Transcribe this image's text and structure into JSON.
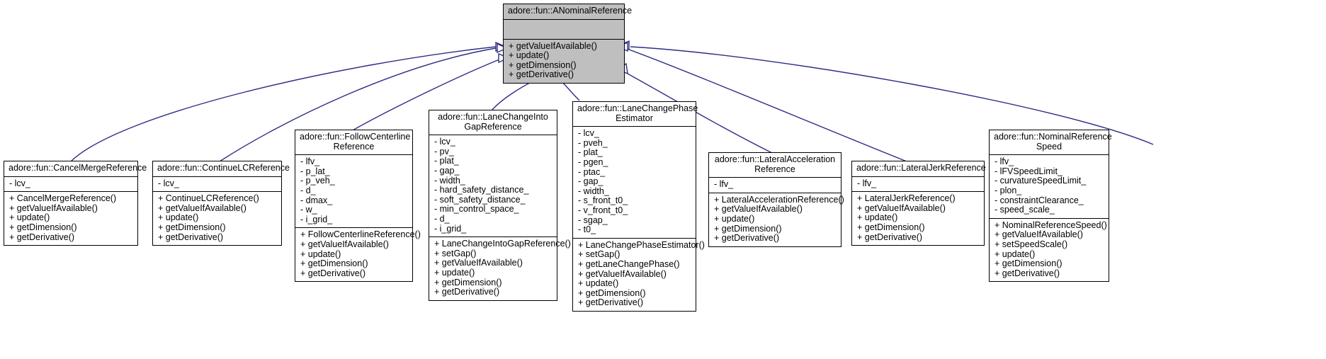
{
  "diagram": {
    "kind": "uml-inheritance",
    "background": "#ffffff",
    "edge_color": "#2d2d86",
    "root_fill": "#bfbfbf",
    "node_fill": "#ffffff",
    "border_color": "#000000"
  },
  "nodes": [
    {
      "id": "anominalreference",
      "title": "adore::fun::ANominalReference",
      "attrs": [],
      "ops": [
        "+ getValueIfAvailable()",
        "+ update()",
        "+ getDimension()",
        "+ getDerivative()"
      ]
    },
    {
      "id": "cancelmergereference",
      "title": "adore::fun::CancelMergeReference",
      "attrs": [
        "- lcv_"
      ],
      "ops": [
        "+ CancelMergeReference()",
        "+ getValueIfAvailable()",
        "+ update()",
        "+ getDimension()",
        "+ getDerivative()"
      ]
    },
    {
      "id": "continuelcreference",
      "title": "adore::fun::ContinueLCReference",
      "attrs": [
        "- lcv_"
      ],
      "ops": [
        "+ ContinueLCReference()",
        "+ getValueIfAvailable()",
        "+ update()",
        "+ getDimension()",
        "+ getDerivative()"
      ]
    },
    {
      "id": "followcenterlinereference",
      "title": "adore::fun::FollowCenterline\nReference",
      "attrs": [
        "- lfv_",
        "- p_lat_",
        "- p_veh_",
        "- d_",
        "- dmax_",
        "- w_",
        "- i_grid_"
      ],
      "ops": [
        "+ FollowCenterlineReference()",
        "+ getValueIfAvailable()",
        "+ update()",
        "+ getDimension()",
        "+ getDerivative()"
      ]
    },
    {
      "id": "lanechangeintogapreference",
      "title": "adore::fun::LaneChangeInto\nGapReference",
      "attrs": [
        "- lcv_",
        "- pv_",
        "- plat_",
        "- gap_",
        "- width_",
        "- hard_safety_distance_",
        "- soft_safety_distance_",
        "- min_control_space_",
        "- d_",
        "- i_grid_"
      ],
      "ops": [
        "+ LaneChangeIntoGapReference()",
        "+ setGap()",
        "+ getValueIfAvailable()",
        "+ update()",
        "+ getDimension()",
        "+ getDerivative()"
      ]
    },
    {
      "id": "lanechangephaseestimator",
      "title": "adore::fun::LaneChangePhase\nEstimator",
      "attrs": [
        "- lcv_",
        "- pveh_",
        "- plat_",
        "- pgen_",
        "- ptac_",
        "- gap_",
        "- width_",
        "- s_front_t0_",
        "- v_front_t0_",
        "- sgap_",
        "- t0_"
      ],
      "ops": [
        "+ LaneChangePhaseEstimator()",
        "+ setGap()",
        "+ getLaneChangePhase()",
        "+ getValueIfAvailable()",
        "+ update()",
        "+ getDimension()",
        "+ getDerivative()"
      ]
    },
    {
      "id": "lateralaccelerationreference",
      "title": "adore::fun::LateralAcceleration\nReference",
      "attrs": [
        "- lfv_"
      ],
      "ops": [
        "+ LateralAccelerationReference()",
        "+ getValueIfAvailable()",
        "+ update()",
        "+ getDimension()",
        "+ getDerivative()"
      ]
    },
    {
      "id": "lateraljerkreference",
      "title": "adore::fun::LateralJerkReference",
      "attrs": [
        "- lfv_"
      ],
      "ops": [
        "+ LateralJerkReference()",
        "+ getValueIfAvailable()",
        "+ update()",
        "+ getDimension()",
        "+ getDerivative()"
      ]
    },
    {
      "id": "nominalreferencespeed",
      "title": "adore::fun::NominalReference\nSpeed",
      "attrs": [
        "- lfv_",
        "- lFVSpeedLimit_",
        "- curvatureSpeedLimit_",
        "- plon_",
        "- constraintClearance_",
        "- speed_scale_"
      ],
      "ops": [
        "+ NominalReferenceSpeed()",
        "+ getValueIfAvailable()",
        "+ setSpeedScale()",
        "+ update()",
        "+ getDimension()",
        "+ getDerivative()"
      ]
    }
  ]
}
